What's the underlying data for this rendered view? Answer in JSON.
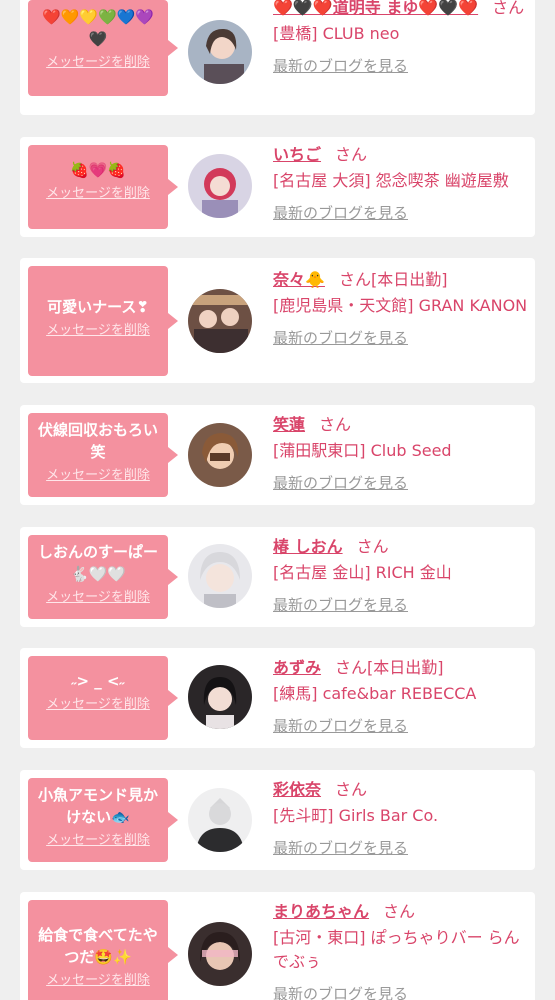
{
  "colors": {
    "accent": "#d9456a",
    "bubble": "#f4919f",
    "background": "#efefef",
    "blog_link": "#999999"
  },
  "entries": [
    {
      "message": "❤️🧡💛💚💙💜\n🖤",
      "delete_label": "メッセージを削除",
      "name": "❤️🖤❤️道明寺 まゆ❤️🖤❤️",
      "honorific": "さん",
      "status": "",
      "shop": "[豊橋] CLUB neo",
      "blog_label": "最新のブログを見る",
      "avatar_icon": "cast-photo-avatar"
    },
    {
      "message": "🍓💗🍓",
      "delete_label": "メッセージを削除",
      "name": "いちご",
      "honorific": "さん",
      "status": "",
      "shop": "[名古屋 大須] 怨念喫茶 幽遊屋敷",
      "blog_label": "最新のブログを見る",
      "avatar_icon": "cast-photo-avatar"
    },
    {
      "message": "可愛いナース❣",
      "delete_label": "メッセージを削除",
      "name": "奈々🐥",
      "honorific": "さん",
      "status": "[本日出勤]",
      "shop": "[鹿児島県・天文館] GRAN KANON",
      "blog_label": "最新のブログを見る",
      "avatar_icon": "cast-photo-avatar"
    },
    {
      "message": "伏線回収おもろい笑",
      "delete_label": "メッセージを削除",
      "name": "笑蓮",
      "honorific": "さん",
      "status": "",
      "shop": "[蒲田駅東口] Club Seed",
      "blog_label": "最新のブログを見る",
      "avatar_icon": "cast-photo-avatar"
    },
    {
      "message": "しおんのすーぱー🐇🤍🤍",
      "delete_label": "メッセージを削除",
      "name": "椿 しおん",
      "honorific": "さん",
      "status": "",
      "shop": "[名古屋 金山] RICH 金山",
      "blog_label": "最新のブログを見る",
      "avatar_icon": "cast-photo-avatar"
    },
    {
      "message": "˶> _ <˶",
      "delete_label": "メッセージを削除",
      "name": "あずみ",
      "honorific": "さん",
      "status": "[本日出勤]",
      "shop": "[練馬] cafe&bar REBECCA",
      "blog_label": "最新のブログを見る",
      "avatar_icon": "cast-photo-avatar"
    },
    {
      "message": "小魚アモンド見かけない🐟",
      "delete_label": "メッセージを削除",
      "name": "彩依奈",
      "honorific": "さん",
      "status": "",
      "shop": "[先斗町] Girls Bar Co.",
      "blog_label": "最新のブログを見る",
      "avatar_icon": "default-avatar-silhouette"
    },
    {
      "message": "給食で食べてたやつだ🤩✨",
      "delete_label": "メッセージを削除",
      "name": "まりあちゃん",
      "honorific": "さん",
      "status": "",
      "shop": "[古河・東口] ぽっちゃりバー らんでぶぅ",
      "blog_label": "最新のブログを見る",
      "avatar_icon": "cast-photo-avatar"
    }
  ]
}
